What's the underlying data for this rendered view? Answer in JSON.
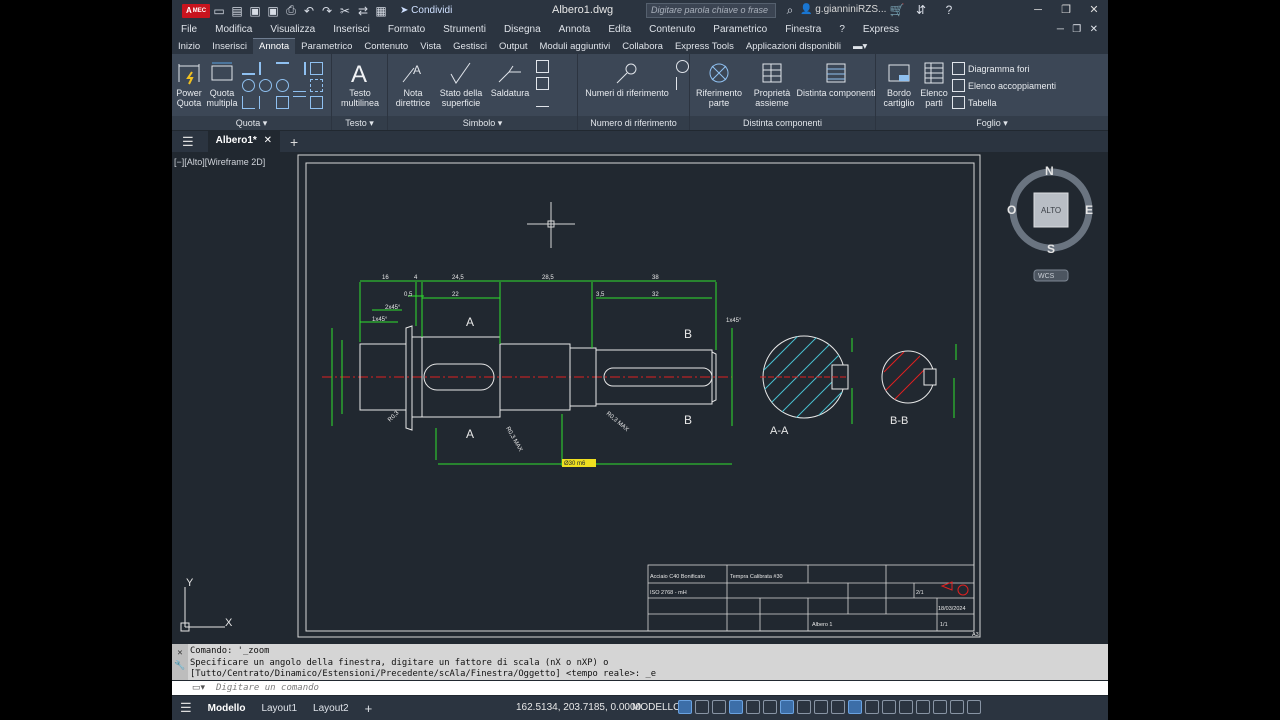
{
  "app": {
    "logo": "A",
    "logo_sub": "MEC",
    "doc_title": "Albero1.dwg",
    "share": "Condividi",
    "search_placeholder": "Digitare parola chiave o frase",
    "user": "g.gianniniRZS..."
  },
  "menu": [
    "File",
    "Modifica",
    "Visualizza",
    "Inserisci",
    "Formato",
    "Strumenti",
    "Disegna",
    "Annota",
    "Edita",
    "Contenuto",
    "Parametrico",
    "Finestra",
    "?",
    "Express"
  ],
  "ribbon_tabs": [
    "Inizio",
    "Inserisci",
    "Annota",
    "Parametrico",
    "Contenuto",
    "Vista",
    "Gestisci",
    "Output",
    "Moduli aggiuntivi",
    "Collabora",
    "Express Tools",
    "Applicazioni disponibili"
  ],
  "ribbon_active": "Annota",
  "panels": {
    "quota": {
      "title": "Quota",
      "power": "Power\nQuota",
      "multi": "Quota\nmultipla"
    },
    "testo": {
      "title": "Testo",
      "multiline": "Testo\nmultilinea"
    },
    "simbolo": {
      "title": "Simbolo",
      "nota": "Nota\ndirettrice",
      "stato": "Stato della\nsuperficie",
      "saldatura": "Saldatura"
    },
    "numrif": {
      "title": "Numero di riferimento",
      "btn": "Numeri di riferimento"
    },
    "distinta": {
      "title": "Distinta componenti",
      "rif": "Riferimento\nparte",
      "prop": "Proprietà\nassieme",
      "dist": "Distinta componenti"
    },
    "foglio": {
      "title": "Foglio",
      "bordo": "Bordo\ncartiglio",
      "elenco": "Elenco\nparti",
      "diag": "Diagramma fori",
      "acc": "Elenco accoppiamenti",
      "tab": "Tabella"
    }
  },
  "file_tab": "Albero1*",
  "viewport_label": "[−][Alto][Wireframe 2D]",
  "viewcube": {
    "n": "N",
    "s": "S",
    "e": "E",
    "w": "O",
    "face": "ALTO",
    "wcs": "WCS"
  },
  "drawing": {
    "dims_top": [
      "16",
      "4",
      "24,5",
      "28,5",
      "38"
    ],
    "dims_mid": [
      "0,5",
      "22",
      "3,5",
      "32"
    ],
    "chamfers": [
      "2x45°",
      "1x45°",
      "1x45°"
    ],
    "sections": [
      "A",
      "A",
      "B",
      "B"
    ],
    "views": [
      "A-A",
      "B-B"
    ],
    "radii": [
      "R0,3",
      "R0,3 MAX",
      "R0,3 MAX"
    ],
    "total": "Ø30 m6",
    "title_block": {
      "material": "Acciaio C40 Bonificato",
      "treatment": "Tempra Calibrata #30",
      "std": "ISO 2768 - mH",
      "scale": "2/1",
      "date": "18/03/2024",
      "name": "Albero 1",
      "sheet": "1/1",
      "size": "A3"
    }
  },
  "command": {
    "lines": [
      "Comando: '_zoom",
      "Specificare un angolo della finestra, digitare un fattore di scala (nX o nXP) o",
      "[Tutto/Centrato/Dinamico/Estensioni/Precedente/scAla/Finestra/Oggetto] <tempo reale>:  _e"
    ],
    "placeholder": "Digitare un comando"
  },
  "status": {
    "tabs": [
      "Modello",
      "Layout1",
      "Layout2"
    ],
    "coords": "162.5134, 203.7185, 0.0000",
    "mode": "MODELLO"
  }
}
